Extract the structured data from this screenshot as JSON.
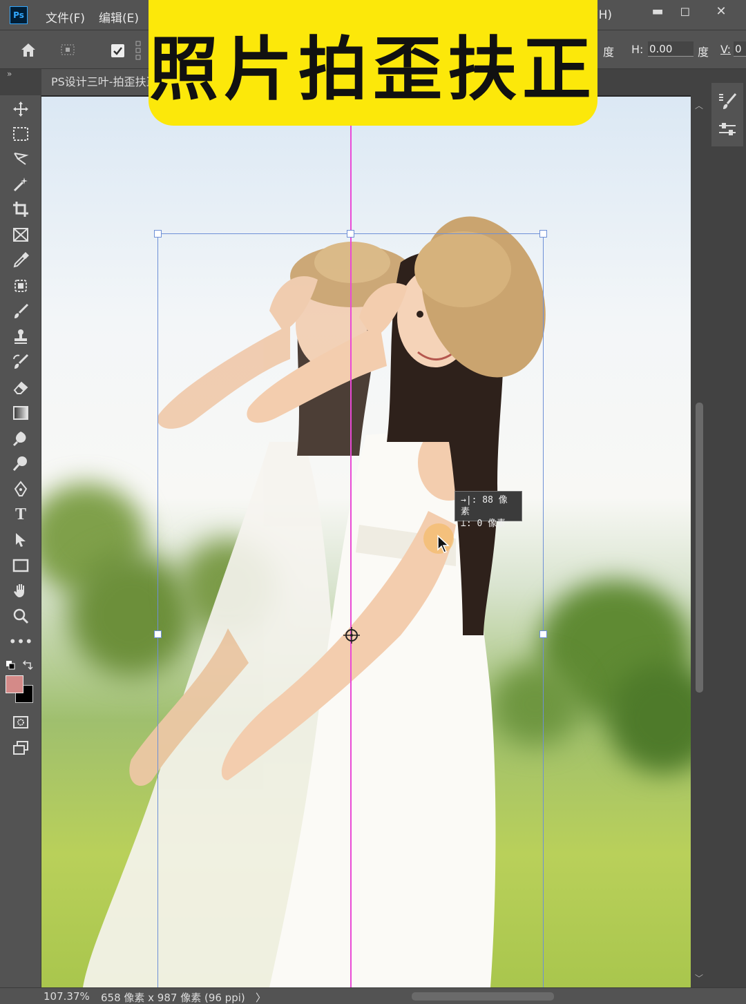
{
  "app": {
    "logo": "Ps"
  },
  "menu": {
    "file": "文件(F)",
    "edit": "编辑(E)",
    "help_suffix": "(H)"
  },
  "window_controls": {
    "minimize": "▬",
    "restore": "◻",
    "close": "✕"
  },
  "options": {
    "deg_label_1": "度",
    "h_label": "H:",
    "h_value": "0.00",
    "deg_label_2": "度",
    "v_label": "V:",
    "v_value": "0"
  },
  "document": {
    "tab_title": "PS设计三叶-拍歪扶正"
  },
  "banner": {
    "title": "照片拍歪扶正"
  },
  "tooltip": {
    "line1": "→|: 88 像素",
    "line2": "⊥:  0 像素"
  },
  "status": {
    "zoom": "107.37%",
    "doc_info": "658 像素 x 987 像素 (96 ppi)",
    "arrow": "〉"
  },
  "colors": {
    "foreground": "#d48a88",
    "background": "#000000",
    "banner": "#fce80a",
    "guide": "#e94ad6",
    "bbox": "#6d8fd6"
  }
}
